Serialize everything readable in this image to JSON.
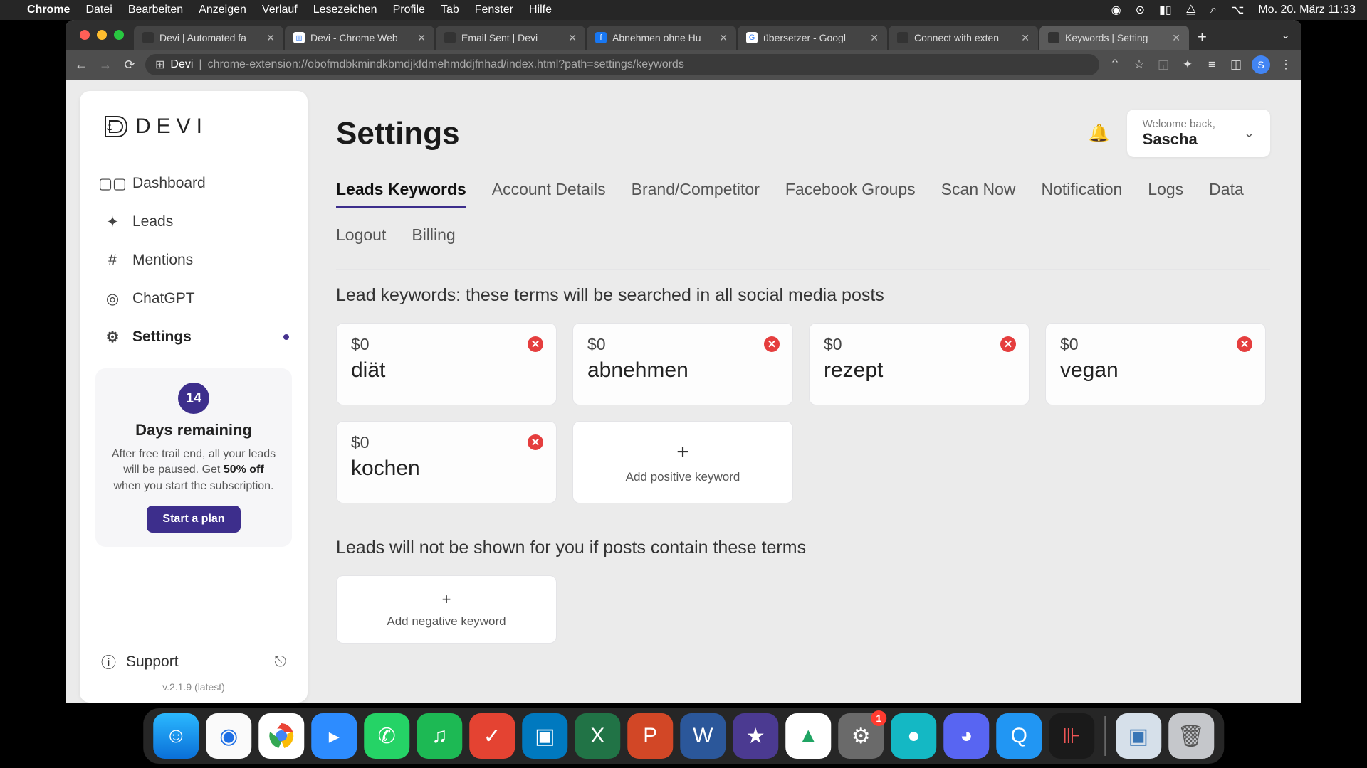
{
  "menubar": {
    "app": "Chrome",
    "items": [
      "Datei",
      "Bearbeiten",
      "Anzeigen",
      "Verlauf",
      "Lesezeichen",
      "Profile",
      "Tab",
      "Fenster",
      "Hilfe"
    ],
    "clock": "Mo. 20. März  11:33"
  },
  "tabs": [
    {
      "title": "Devi | Automated fa",
      "favicon_bg": "#333"
    },
    {
      "title": "Devi - Chrome Web",
      "favicon_bg": "#4285f4"
    },
    {
      "title": "Email Sent | Devi",
      "favicon_bg": "#333"
    },
    {
      "title": "Abnehmen ohne Hu",
      "favicon_bg": "#1877f2",
      "favicon_char": "f"
    },
    {
      "title": "übersetzer - Googl",
      "favicon_bg": "#fff",
      "favicon_char": "G"
    },
    {
      "title": "Connect with exten",
      "favicon_bg": "#333"
    },
    {
      "title": "Keywords | Setting",
      "favicon_bg": "#333",
      "active": true
    }
  ],
  "url": {
    "domain": "Devi",
    "path": "chrome-extension://obofmdbkmindkbmdjkfdmehmddjfnhad/index.html?path=settings/keywords"
  },
  "profile_initial": "S",
  "logo_text": "DEVI",
  "sidebar": {
    "items": [
      {
        "label": "Dashboard",
        "icon": "▢▢"
      },
      {
        "label": "Leads",
        "icon": "✦"
      },
      {
        "label": "Mentions",
        "icon": "#"
      },
      {
        "label": "ChatGPT",
        "icon": "◎"
      },
      {
        "label": "Settings",
        "icon": "⚙",
        "active": true
      }
    ],
    "trial": {
      "days": "14",
      "title": "Days remaining",
      "desc_pre": "After free trail end, all your leads will be paused. Get ",
      "desc_bold": "50% off",
      "desc_post": " when you start the subscription.",
      "button": "Start a plan"
    },
    "support": "Support",
    "version": "v.2.1.9 (latest)"
  },
  "header": {
    "title": "Settings",
    "welcome": "Welcome back,",
    "username": "Sascha"
  },
  "settings_tabs": [
    "Leads Keywords",
    "Account Details",
    "Brand/Competitor",
    "Facebook Groups",
    "Scan Now",
    "Notification",
    "Logs",
    "Data",
    "Logout",
    "Billing"
  ],
  "active_tab_index": 0,
  "positive": {
    "heading": "Lead keywords: these terms will be searched in all social media posts",
    "add_label": "Add positive keyword",
    "keywords": [
      {
        "price": "$0",
        "term": "diät"
      },
      {
        "price": "$0",
        "term": "abnehmen"
      },
      {
        "price": "$0",
        "term": "rezept"
      },
      {
        "price": "$0",
        "term": "vegan"
      },
      {
        "price": "$0",
        "term": "kochen"
      }
    ]
  },
  "negative": {
    "heading": "Leads will not be shown for you if posts contain these terms",
    "add_label": "Add negative keyword"
  },
  "dock_badge": "1"
}
